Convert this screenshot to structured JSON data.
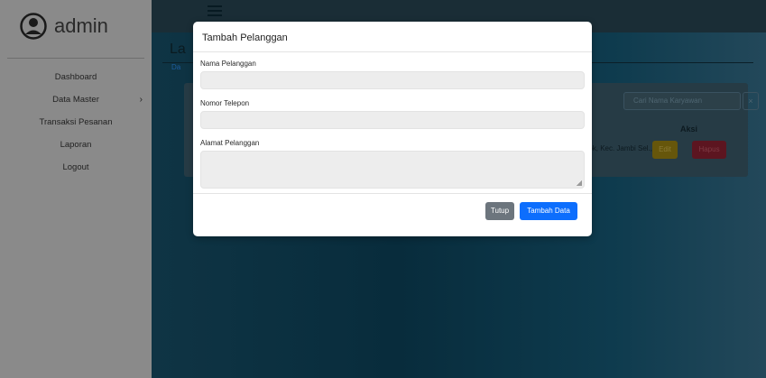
{
  "sidebar": {
    "brand": "admin",
    "items": [
      {
        "label": "Dashboard"
      },
      {
        "label": "Data Master"
      },
      {
        "label": "Transaksi Pesanan"
      },
      {
        "label": "Laporan"
      },
      {
        "label": "Logout"
      }
    ]
  },
  "background": {
    "page_title": "La",
    "breadcrumb": "Da",
    "search_placeholder": "Cari Nama Karyawan",
    "search_clear": "×",
    "column_aksi": "Aksi",
    "cell_alamat": "ok, Kec. Jambi Sel.,",
    "edit_label": "Edit",
    "hapus_label": "Hapus"
  },
  "modal": {
    "title": "Tambah Pelanggan",
    "fields": [
      {
        "label": "Nama Pelanggan",
        "value": ""
      },
      {
        "label": "Nomor Telepon",
        "value": ""
      },
      {
        "label": "Alamat Pelanggan",
        "value": ""
      }
    ],
    "close_label": "Tutup",
    "submit_label": "Tambah Data"
  },
  "colors": {
    "primary": "#0d6efd",
    "secondary": "#6c757d",
    "sidebar_bg": "#8a8a8a"
  },
  "icons": {
    "avatar": "user-circle-icon",
    "chevron": "chevron-right-icon",
    "menu": "hamburger-icon"
  }
}
